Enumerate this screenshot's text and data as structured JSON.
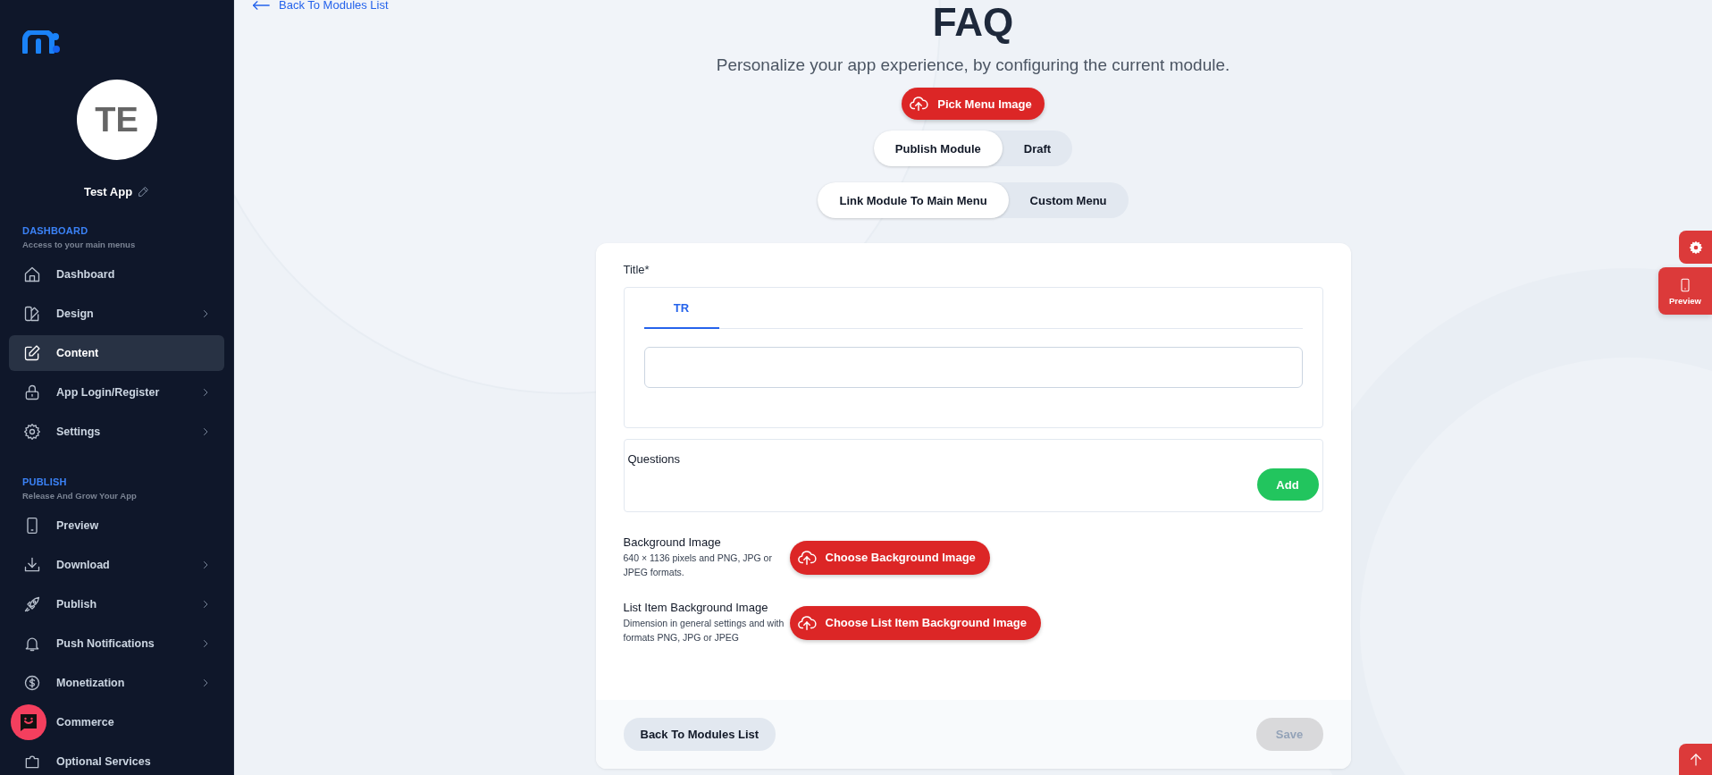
{
  "sidebar": {
    "app_initials": "TE",
    "app_name": "Test App",
    "sections": [
      {
        "heading": "DASHBOARD",
        "subtitle": "Access to your main menus",
        "items": [
          {
            "label": "Dashboard",
            "has_submenu": false,
            "selected": false
          },
          {
            "label": "Design",
            "has_submenu": true,
            "selected": false
          },
          {
            "label": "Content",
            "has_submenu": false,
            "selected": true
          },
          {
            "label": "App Login/Register",
            "has_submenu": true,
            "selected": false
          },
          {
            "label": "Settings",
            "has_submenu": true,
            "selected": false
          }
        ]
      },
      {
        "heading": "PUBLISH",
        "subtitle": "Release And Grow Your App",
        "items": [
          {
            "label": "Preview",
            "has_submenu": false,
            "selected": false
          },
          {
            "label": "Download",
            "has_submenu": true,
            "selected": false
          },
          {
            "label": "Publish",
            "has_submenu": true,
            "selected": false
          },
          {
            "label": "Push Notifications",
            "has_submenu": true,
            "selected": false
          },
          {
            "label": "Monetization",
            "has_submenu": true,
            "selected": false
          },
          {
            "label": "Commerce",
            "has_submenu": false,
            "selected": false
          },
          {
            "label": "Optional Services",
            "has_submenu": false,
            "selected": false
          }
        ]
      }
    ]
  },
  "back_link": "Back To Modules List",
  "page_title": "FAQ",
  "subtitle": "Personalize your app experience, by configuring the current module.",
  "pick_menu_image": "Pick Menu Image",
  "status_toggle": [
    {
      "label": "Publish Module",
      "selected": true
    },
    {
      "label": "Draft",
      "selected": false
    }
  ],
  "menu_toggle": [
    {
      "label": "Link Module To Main Menu",
      "selected": true
    },
    {
      "label": "Custom Menu",
      "selected": false
    }
  ],
  "form": {
    "title_label": "Title*",
    "language_tabs": [
      {
        "label": "TR",
        "selected": true
      }
    ],
    "questions_label": "Questions",
    "add_button": "Add",
    "images": [
      {
        "label": "Background Image",
        "hint": "640 × 1136 pixels and PNG, JPG or JPEG formats.",
        "button": "Choose Background Image"
      },
      {
        "label": "List Item Background Image",
        "hint": "Dimension in general settings and with formats PNG, JPG or JPEG",
        "button": "Choose List Item Background Image"
      }
    ]
  },
  "footer": {
    "back_button": "Back To Modules List",
    "save_button": {
      "label": "Save",
      "disabled": true
    }
  },
  "floating": {
    "preview_label": "Preview"
  }
}
